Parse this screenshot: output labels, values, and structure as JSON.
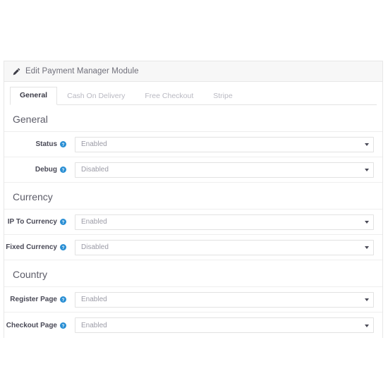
{
  "panel": {
    "header": {
      "icon": "pencil-icon",
      "title": "Edit Payment Manager Module"
    },
    "tabs": [
      {
        "label": "General",
        "active": true
      },
      {
        "label": "Cash On Delivery",
        "active": false
      },
      {
        "label": "Free Checkout",
        "active": false
      },
      {
        "label": "Stripe",
        "active": false
      }
    ],
    "sections": [
      {
        "title": "General",
        "rows": [
          {
            "label": "Status",
            "help_icon": "help-circle-icon",
            "value": "Enabled",
            "control": "select"
          },
          {
            "label": "Debug",
            "help_icon": "help-circle-icon",
            "value": "Disabled",
            "control": "select"
          }
        ]
      },
      {
        "title": "Currency",
        "rows": [
          {
            "label": "IP To Currency",
            "help_icon": "help-circle-icon",
            "value": "Enabled",
            "control": "select"
          },
          {
            "label": "Fixed Currency",
            "help_icon": "help-circle-icon",
            "value": "Disabled",
            "control": "select"
          }
        ]
      },
      {
        "title": "Country",
        "rows": [
          {
            "label": "Register Page",
            "help_icon": "help-circle-icon",
            "value": "Enabled",
            "control": "select"
          },
          {
            "label": "Checkout Page",
            "help_icon": "help-circle-icon",
            "value": "Enabled",
            "control": "select"
          }
        ]
      }
    ]
  },
  "colors": {
    "panel_border": "#e7e7e7",
    "heading_bg": "#f7f7f7",
    "help_icon_blue": "#2a8fd4",
    "label_text": "#4a4a57",
    "value_text": "#9b9ba6",
    "tab_inactive": "#b9b9c2",
    "tab_active": "#3a3a46"
  }
}
